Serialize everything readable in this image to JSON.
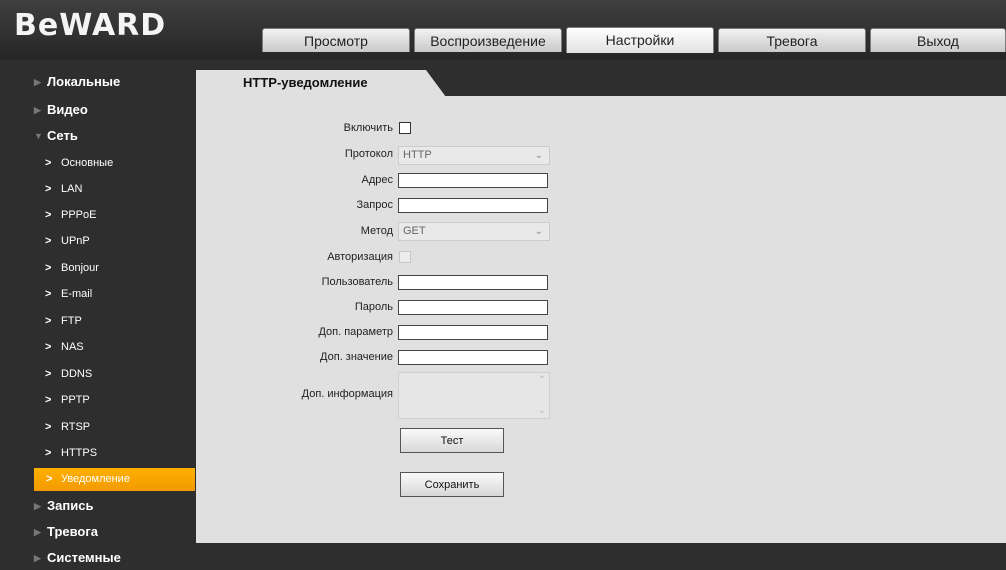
{
  "header": {
    "logo": "BeWARD",
    "tabs": [
      {
        "label": "Просмотр"
      },
      {
        "label": "Воспроизведение"
      },
      {
        "label": "Настройки"
      },
      {
        "label": "Тревога"
      },
      {
        "label": "Выход"
      }
    ],
    "active_tab": "Настройки"
  },
  "sidebar": {
    "top": [
      {
        "label": "Локальные",
        "expanded": false
      },
      {
        "label": "Видео",
        "expanded": false
      },
      {
        "label": "Сеть",
        "expanded": true
      }
    ],
    "sub": [
      {
        "label": "Основные"
      },
      {
        "label": "LAN"
      },
      {
        "label": "PPPoE"
      },
      {
        "label": "UPnP"
      },
      {
        "label": "Bonjour"
      },
      {
        "label": "E-mail"
      },
      {
        "label": "FTP"
      },
      {
        "label": "NAS"
      },
      {
        "label": "DDNS"
      },
      {
        "label": "PPTP"
      },
      {
        "label": "RTSP"
      },
      {
        "label": "HTTPS"
      },
      {
        "label": "Уведомление"
      }
    ],
    "bottom": [
      {
        "label": "Запись"
      },
      {
        "label": "Тревога"
      },
      {
        "label": "Системные"
      }
    ],
    "active_item": "Уведомление",
    "active_color": "#f8a400"
  },
  "main": {
    "section_title": "HTTP-уведомление",
    "form": {
      "enable_label": "Включить",
      "enable_checked": false,
      "protocol_label": "Протокол",
      "protocol_value": "HTTP",
      "address_label": "Адрес",
      "address_value": "",
      "request_label": "Запрос",
      "request_value": "",
      "method_label": "Метод",
      "method_value": "GET",
      "auth_label": "Авторизация",
      "auth_checked": false,
      "user_label": "Пользователь",
      "user_value": "",
      "password_label": "Пароль",
      "password_value": "",
      "extra_param_label": "Доп. параметр",
      "extra_param_value": "",
      "extra_value_label": "Доп. значение",
      "extra_value_value": "",
      "extra_info_label": "Доп. информация",
      "extra_info_value": "",
      "test_button": "Тест",
      "save_button": "Сохранить"
    }
  }
}
